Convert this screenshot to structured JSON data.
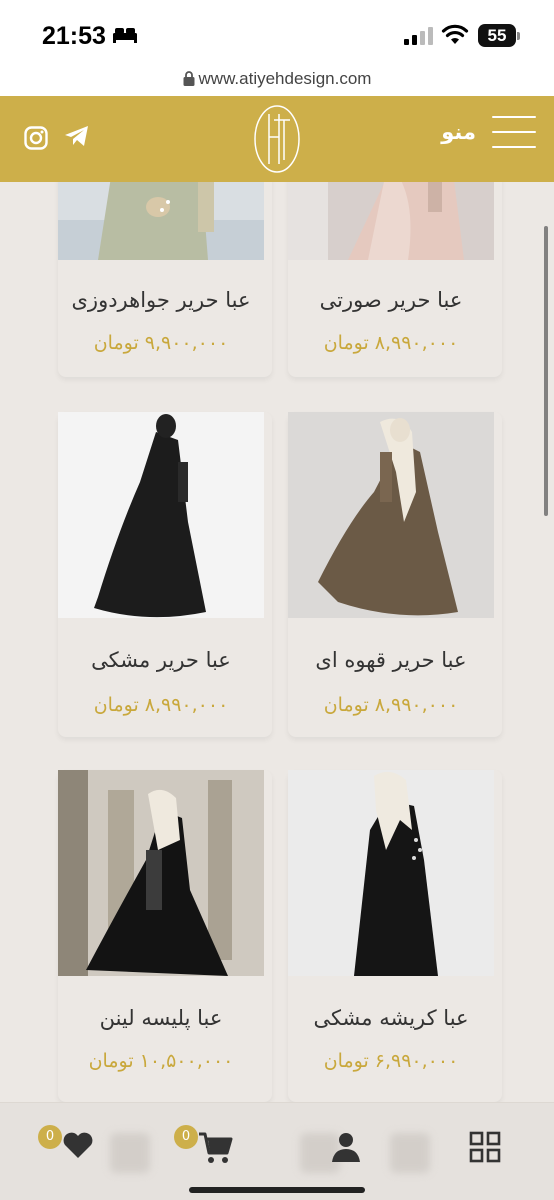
{
  "status_bar": {
    "time": "21:53",
    "battery": "55",
    "icons": [
      "bed-icon",
      "signal-icon",
      "wifi-icon",
      "battery-icon"
    ]
  },
  "url_bar": {
    "url": "www.atiyehdesign.com",
    "icon": "lock-icon"
  },
  "header": {
    "menu_label": "منو",
    "icons": [
      "hamburger-icon",
      "logo",
      "telegram-icon",
      "instagram-icon"
    ],
    "colors": {
      "brand": "#cdaf4a"
    }
  },
  "products": [
    {
      "name": "عبا حریر صورتی",
      "price": "۸,۹۹۰,۰۰۰ تومان"
    },
    {
      "name": "عبا حریر جواهردوزی",
      "price": "۹,۹۰۰,۰۰۰ تومان"
    },
    {
      "name": "عبا حریر قهوه ای",
      "price": "۸,۹۹۰,۰۰۰ تومان"
    },
    {
      "name": "عبا حریر مشکی",
      "price": "۸,۹۹۰,۰۰۰ تومان"
    },
    {
      "name": "عبا کریشه مشکی",
      "price": "۶,۹۹۰,۰۰۰ تومان"
    },
    {
      "name": "عبا پلیسه لینن",
      "price": "۱۰,۵۰۰,۰۰۰ تومان"
    }
  ],
  "bottom_nav": {
    "wishlist_count": "0",
    "cart_count": "0",
    "icons": [
      "heart-icon",
      "cart-icon",
      "user-icon",
      "grid-icon"
    ]
  },
  "colors": {
    "price": "#c9a83c",
    "background": "#ece8e4"
  }
}
